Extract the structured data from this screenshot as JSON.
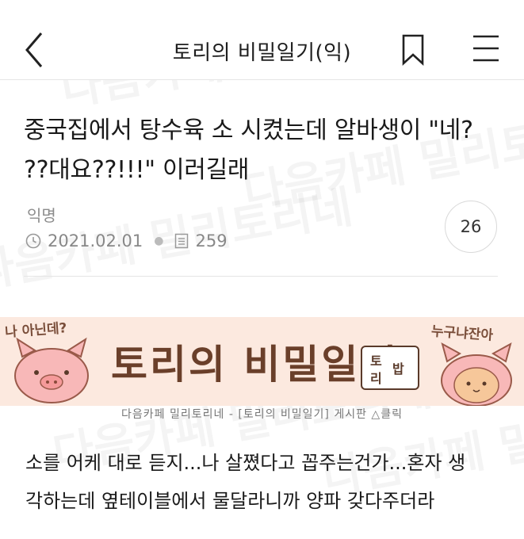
{
  "header": {
    "title": "토리의 비밀일기(익)"
  },
  "watermark": {
    "text": "다음카페 밀리토리네"
  },
  "post": {
    "title_line1": "중국집에서 탕수육 소 시켰는데 알바생이 \"네?",
    "title_line2": "??대요??!!!\" 이러길래",
    "author": "익명",
    "date": "2021.02.01",
    "views": "259",
    "comment_count": "26"
  },
  "banner": {
    "left_text": "나 아닌데?",
    "right_text": "누구냐잔아",
    "title": "토리의 비밀일기",
    "stamp_top": "토",
    "stamp_bottom": "리",
    "stamp_right": "밥",
    "caption": "다음카페 밀리토리네 - [토리의 비밀일기] 게시판 △클릭"
  },
  "body": {
    "line1": "소를 어케 대로 듣지...나 살쪘다고 꼽주는건가...혼자 생",
    "line2": "각하는데 옆테이블에서 물달라니까 양파 갖다주더라"
  },
  "colors": {
    "text": "#1a1a1a",
    "meta": "#888888",
    "banner_bg": "#fce9df"
  }
}
